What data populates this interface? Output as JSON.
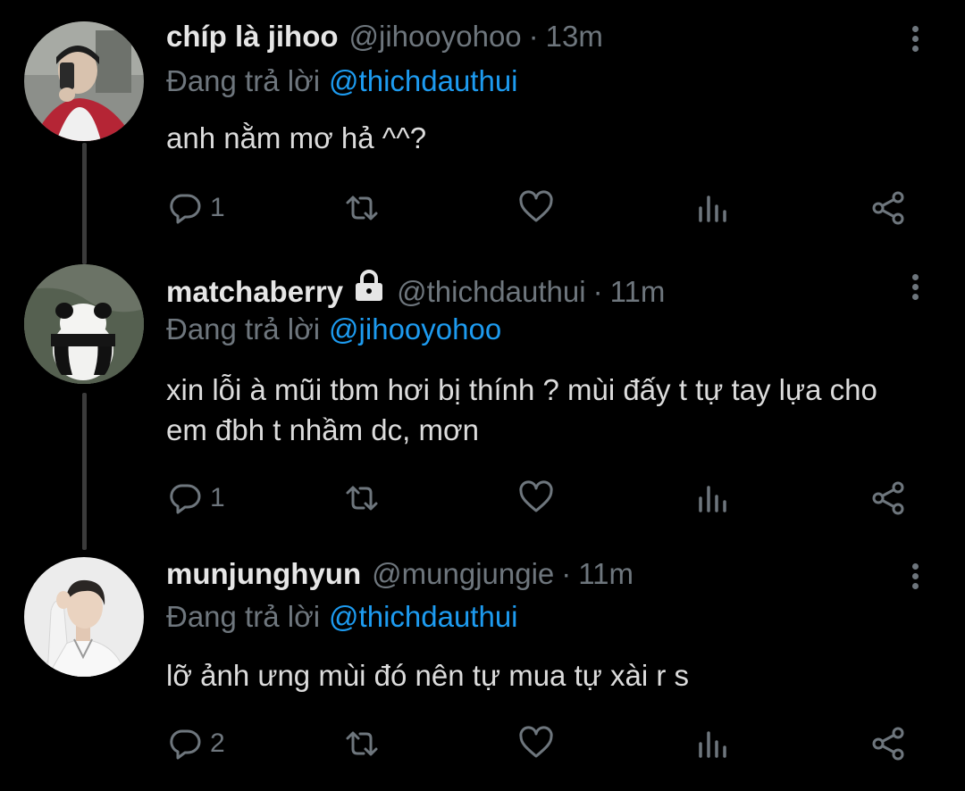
{
  "tweets": [
    {
      "name": "chíp là jihoo",
      "handle": "@jihooyohoo",
      "separator": "·",
      "time": "13m",
      "replying_prefix": "Đang trả lời",
      "replying_to": "@thichdauthui",
      "text": "anh nằm mơ hả ^^?",
      "reply_count": "1",
      "locked": false
    },
    {
      "name": "matchaberry",
      "handle": "@thichdauthui",
      "separator": "·",
      "time": "11m",
      "replying_prefix": "Đang trả lời",
      "replying_to": "@jihooyohoo",
      "text": "xin lỗi à mũi tbm hơi bị thính ? mùi đấy t tự tay lựa cho em đbh t nhầm dc, mơn",
      "reply_count": "1",
      "locked": true
    },
    {
      "name": "munjunghyun",
      "handle": "@mungjungie",
      "separator": "·",
      "time": "11m",
      "replying_prefix": "Đang trả lời",
      "replying_to": "@thichdauthui",
      "text": "lỡ ảnh ưng mùi đó nên tự mua tự xài r s",
      "reply_count": "2",
      "locked": false
    }
  ],
  "colors": {
    "background": "#000000",
    "muted": "#6e767d",
    "mention": "#1d9bf0",
    "thread_line": "#3b3b3b"
  },
  "icons": [
    "reply-icon",
    "retweet-icon",
    "like-icon",
    "analytics-icon",
    "share-icon",
    "more-options-icon",
    "lock-icon"
  ]
}
